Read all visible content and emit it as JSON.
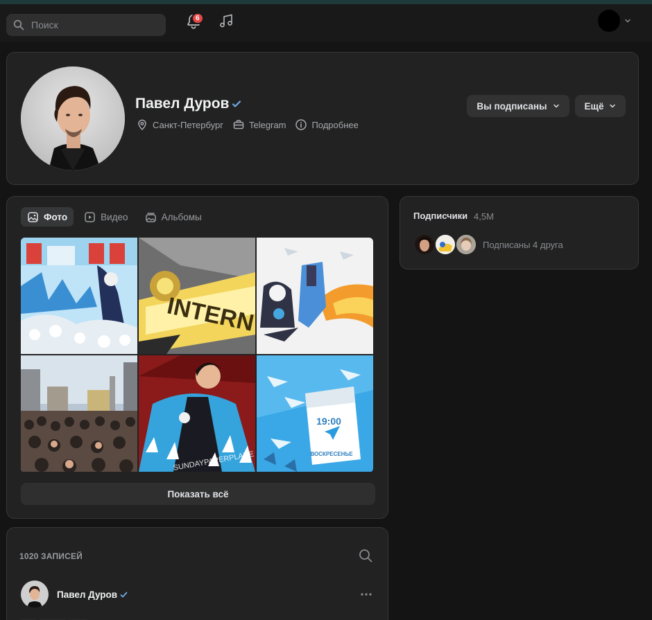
{
  "topbar": {
    "search_placeholder": "Поиск",
    "notifications_count": "6",
    "icons": [
      "search-icon",
      "bell-icon",
      "music-icon",
      "chevron-down-icon"
    ]
  },
  "profile": {
    "name": "Павел Дуров",
    "verified": true,
    "city": "Санкт-Петербург",
    "work": "Telegram",
    "details_link": "Подробнее",
    "subscribed_button": "Вы подписаны",
    "more_button": "Ещё"
  },
  "photos": {
    "tabs": [
      {
        "label": "Фото",
        "icon": "image-icon",
        "active": true
      },
      {
        "label": "Видео",
        "icon": "video-icon",
        "active": false
      },
      {
        "label": "Альбомы",
        "icon": "albums-icon",
        "active": false
      }
    ],
    "thumb_texts": {
      "clock": "19:00",
      "sunday": "ВОСКРЕСЕНЬЕ",
      "intern": "INTERN"
    },
    "show_all": "Показать всё"
  },
  "subscribers": {
    "title": "Подписчики",
    "count": "4,5М",
    "friends_text": "Подписаны 4 друга"
  },
  "wall": {
    "count_label": "1020 ЗАПИСЕЙ",
    "post_author": "Павел Дуров",
    "post_text_preview": "····· ········ ······"
  },
  "colors": {
    "accent": "#71aaeb",
    "badge": "#e64646",
    "card_bg": "#222222",
    "page_bg": "#141414"
  }
}
